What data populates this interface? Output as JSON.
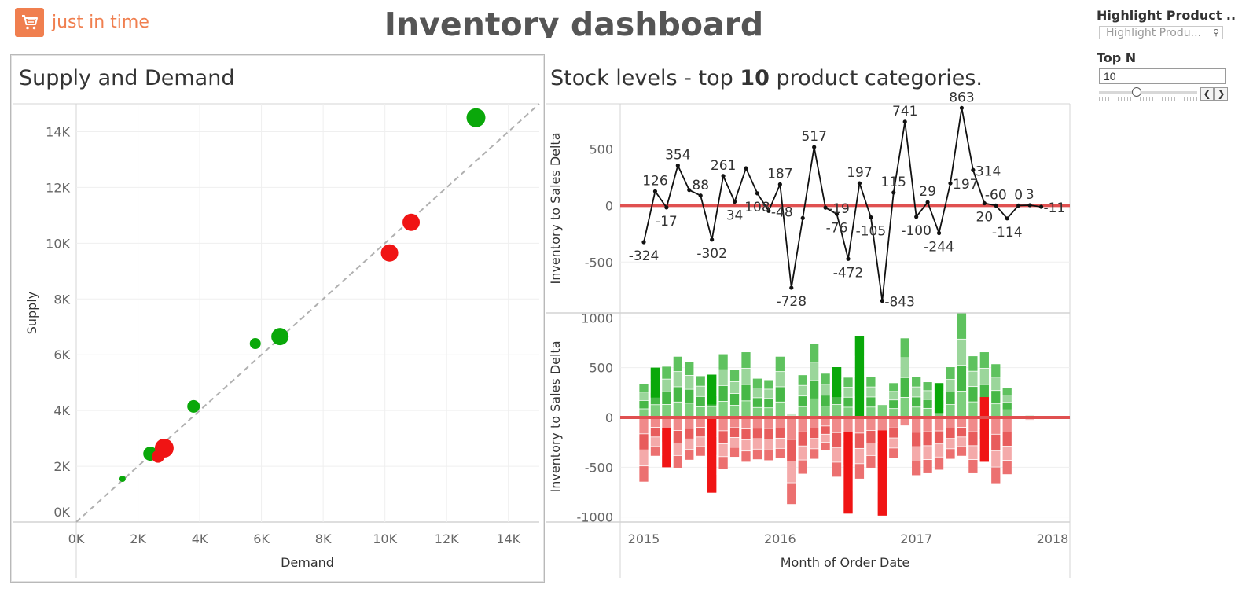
{
  "app": {
    "logo_text": "just in time",
    "logo_icon": "shopping-cart-icon",
    "dashboard_title": "Inventory dashboard"
  },
  "controls": {
    "highlight_label": "Highlight Product ..",
    "highlight_placeholder": "Highlight Produ...",
    "search_icon": "search-icon",
    "topn_label": "Top N",
    "topn_value": "10",
    "prev_icon": "chevron-left-icon",
    "next_icon": "chevron-right-icon"
  },
  "colors": {
    "accent": "#f07f4f",
    "green": "#0aa80a",
    "red": "#f01414",
    "zero_line": "#e05050",
    "text": "#333333"
  },
  "supply_demand": {
    "title": "Supply and Demand"
  },
  "stock_levels": {
    "title_prefix": "Stock levels - top ",
    "title_n": "10",
    "title_suffix": " product categories."
  },
  "chart_data": [
    {
      "type": "scatter",
      "title": "Supply and Demand",
      "xlabel": "Demand",
      "ylabel": "Supply",
      "xlim": [
        0,
        15000
      ],
      "ylim": [
        0,
        15000
      ],
      "x_ticks": [
        "0K",
        "2K",
        "4K",
        "6K",
        "8K",
        "10K",
        "12K",
        "14K"
      ],
      "y_ticks": [
        "0K",
        "2K",
        "4K",
        "6K",
        "8K",
        "10K",
        "12K",
        "14K"
      ],
      "grid": true,
      "reference_line": "supply = demand",
      "points": [
        {
          "x": 1500,
          "y": 1550,
          "size": 4,
          "status": "surplus"
        },
        {
          "x": 2400,
          "y": 2450,
          "size": 9,
          "status": "surplus"
        },
        {
          "x": 2650,
          "y": 2350,
          "size": 8,
          "status": "deficit"
        },
        {
          "x": 2850,
          "y": 2650,
          "size": 12,
          "status": "deficit"
        },
        {
          "x": 3800,
          "y": 4150,
          "size": 8,
          "status": "surplus"
        },
        {
          "x": 5800,
          "y": 6400,
          "size": 7,
          "status": "surplus"
        },
        {
          "x": 6600,
          "y": 6650,
          "size": 11,
          "status": "surplus"
        },
        {
          "x": 10150,
          "y": 9650,
          "size": 11,
          "status": "deficit"
        },
        {
          "x": 10850,
          "y": 10750,
          "size": 11,
          "status": "deficit"
        },
        {
          "x": 12950,
          "y": 14500,
          "size": 12,
          "status": "surplus"
        }
      ]
    },
    {
      "type": "line",
      "title": "Stock levels - top 10 product categories.",
      "xlabel": "Month of Order Date",
      "ylabel": "Inventory to Sales Delta",
      "ylim": [
        -950,
        900
      ],
      "y_ticks": [
        500,
        0,
        -500
      ],
      "x_ticks": [
        "2015",
        "2016",
        "2017",
        "2018"
      ],
      "x": [
        "2015-01",
        "2015-02",
        "2015-03",
        "2015-04",
        "2015-05",
        "2015-06",
        "2015-07",
        "2015-08",
        "2015-09",
        "2015-10",
        "2015-11",
        "2015-12",
        "2016-01",
        "2016-02",
        "2016-03",
        "2016-04",
        "2016-05",
        "2016-06",
        "2016-07",
        "2016-08",
        "2016-09",
        "2016-10",
        "2016-11",
        "2016-12",
        "2017-01",
        "2017-02",
        "2017-03",
        "2017-04",
        "2017-05",
        "2017-06",
        "2017-07",
        "2017-08",
        "2017-09",
        "2017-10",
        "2017-11",
        "2017-12"
      ],
      "values": [
        -324,
        126,
        -17,
        354,
        137,
        88,
        -302,
        261,
        34,
        330,
        108,
        -48,
        187,
        -728,
        -111,
        517,
        -19,
        -76,
        -472,
        197,
        -105,
        -843,
        115,
        741,
        -100,
        29,
        -244,
        197,
        863,
        314,
        20,
        0,
        -114,
        0,
        3,
        -11
      ],
      "labels": [
        {
          "i": 0,
          "text": "-324",
          "pos": "below"
        },
        {
          "i": 1,
          "text": "126",
          "pos": "above"
        },
        {
          "i": 2,
          "text": "-17",
          "pos": "below"
        },
        {
          "i": 3,
          "text": "354",
          "pos": "above"
        },
        {
          "i": 5,
          "text": "88",
          "pos": "above"
        },
        {
          "i": 6,
          "text": "-302",
          "pos": "below"
        },
        {
          "i": 7,
          "text": "261",
          "pos": "above"
        },
        {
          "i": 8,
          "text": "34",
          "pos": "below"
        },
        {
          "i": 10,
          "text": "108",
          "pos": "below"
        },
        {
          "i": 11,
          "text": "-48",
          "pos": "right"
        },
        {
          "i": 12,
          "text": "187",
          "pos": "above"
        },
        {
          "i": 13,
          "text": "-728",
          "pos": "below"
        },
        {
          "i": 15,
          "text": "517",
          "pos": "above"
        },
        {
          "i": 16,
          "text": "-19",
          "pos": "right"
        },
        {
          "i": 17,
          "text": "-76",
          "pos": "below"
        },
        {
          "i": 18,
          "text": "-472",
          "pos": "below"
        },
        {
          "i": 19,
          "text": "197",
          "pos": "above"
        },
        {
          "i": 20,
          "text": "-105",
          "pos": "below"
        },
        {
          "i": 21,
          "text": "-843",
          "pos": "right"
        },
        {
          "i": 22,
          "text": "115",
          "pos": "above"
        },
        {
          "i": 23,
          "text": "741",
          "pos": "above"
        },
        {
          "i": 24,
          "text": "-100",
          "pos": "below"
        },
        {
          "i": 25,
          "text": "29",
          "pos": "above"
        },
        {
          "i": 26,
          "text": "-244",
          "pos": "below"
        },
        {
          "i": 27,
          "text": "197",
          "pos": "right"
        },
        {
          "i": 28,
          "text": "863",
          "pos": "above"
        },
        {
          "i": 29,
          "text": "314",
          "pos": "right"
        },
        {
          "i": 30,
          "text": "20",
          "pos": "below"
        },
        {
          "i": 31,
          "text": "-60",
          "pos": "above"
        },
        {
          "i": 32,
          "text": "-114",
          "pos": "below"
        },
        {
          "i": 33,
          "text": "0",
          "pos": "above"
        },
        {
          "i": 34,
          "text": "3",
          "pos": "above"
        },
        {
          "i": 35,
          "text": "-11",
          "pos": "right"
        }
      ]
    },
    {
      "type": "bar",
      "stacked": true,
      "xlabel": "Month of Order Date",
      "ylabel": "Inventory to Sales Delta",
      "ylim": [
        -1050,
        1050
      ],
      "y_ticks": [
        1000,
        500,
        0,
        -500,
        -1000
      ],
      "x_ticks": [
        "2015",
        "2016",
        "2017",
        "2018"
      ],
      "x": [
        "2015-01",
        "2015-02",
        "2015-03",
        "2015-04",
        "2015-05",
        "2015-06",
        "2015-07",
        "2015-08",
        "2015-09",
        "2015-10",
        "2015-11",
        "2015-12",
        "2016-01",
        "2016-02",
        "2016-03",
        "2016-04",
        "2016-05",
        "2016-06",
        "2016-07",
        "2016-08",
        "2016-09",
        "2016-10",
        "2016-11",
        "2016-12",
        "2017-01",
        "2017-02",
        "2017-03",
        "2017-04",
        "2017-05",
        "2017-06",
        "2017-07",
        "2017-08",
        "2017-09",
        "2017-10",
        "2017-11",
        "2017-12"
      ],
      "positive": [
        335,
        500,
        510,
        610,
        560,
        415,
        430,
        635,
        475,
        655,
        390,
        375,
        610,
        40,
        425,
        735,
        440,
        505,
        400,
        815,
        405,
        125,
        345,
        795,
        405,
        355,
        345,
        505,
        1045,
        615,
        655,
        535,
        295,
        0,
        20,
        10
      ],
      "negative": [
        -645,
        -385,
        -500,
        -505,
        -425,
        -385,
        -755,
        -520,
        -395,
        -445,
        -420,
        -430,
        -410,
        -870,
        -565,
        -415,
        -330,
        -595,
        -965,
        -615,
        -505,
        -985,
        -405,
        -80,
        -580,
        -560,
        -525,
        -415,
        -385,
        -560,
        -445,
        -660,
        -570,
        -10,
        -25,
        -15
      ],
      "highlight_positive": [
        null,
        300,
        null,
        null,
        null,
        null,
        300,
        null,
        null,
        null,
        null,
        null,
        null,
        null,
        null,
        null,
        null,
        300,
        null,
        800,
        null,
        null,
        null,
        null,
        null,
        null,
        300,
        null,
        null,
        null,
        null,
        null,
        null,
        null,
        null,
        null
      ],
      "highlight_negative": [
        null,
        null,
        -390,
        null,
        null,
        null,
        -745,
        null,
        null,
        null,
        null,
        null,
        null,
        null,
        null,
        null,
        null,
        null,
        -820,
        null,
        null,
        -855,
        null,
        null,
        null,
        null,
        null,
        null,
        null,
        null,
        -650,
        null,
        null,
        null,
        null,
        null
      ]
    }
  ]
}
